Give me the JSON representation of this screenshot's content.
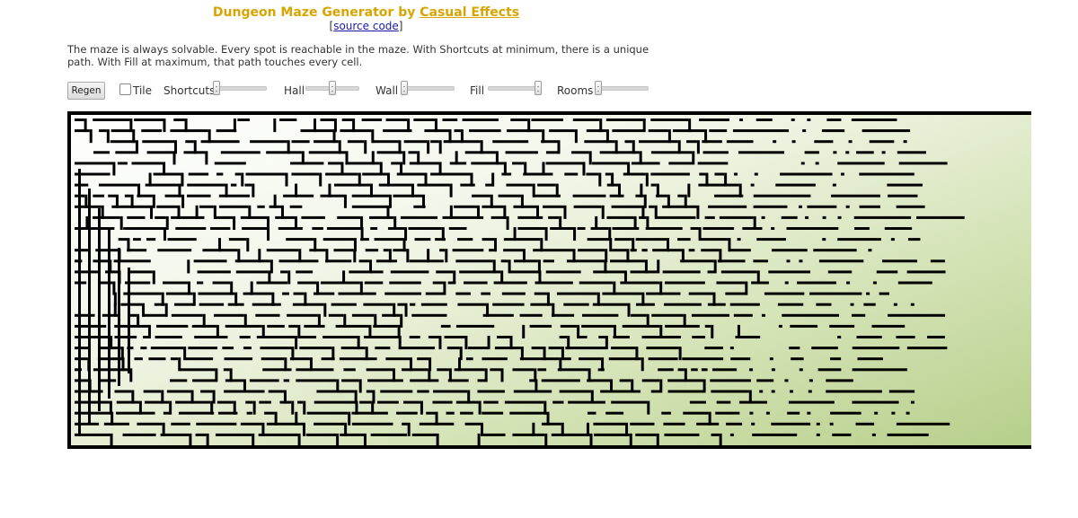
{
  "header": {
    "title_prefix": "Dungeon Maze Generator by ",
    "title_link": "Casual Effects",
    "source_open": "[",
    "source_link": "source code",
    "source_close": "]"
  },
  "description": "The maze is always solvable. Every spot is reachable in the maze. With Shortcuts at minimum, there is a unique path. With Fill at maximum, that path touches every cell.",
  "controls": {
    "regen_label": "Regen",
    "tile_label": "Tile",
    "tile_checked": false,
    "sliders": [
      {
        "label": "Shortcuts",
        "value": 0.0
      },
      {
        "label": "Hall",
        "value": 0.5
      },
      {
        "label": "Wall",
        "value": 0.0
      },
      {
        "label": "Fill",
        "value": 1.0
      },
      {
        "label": "Rooms",
        "value": 0.0
      }
    ]
  },
  "colors": {
    "title": "#d9a400",
    "link": "#1a1aa6",
    "wall": "#000000",
    "maze_bg_start": "#ffffff",
    "maze_bg_end": "#b6cf8a"
  }
}
